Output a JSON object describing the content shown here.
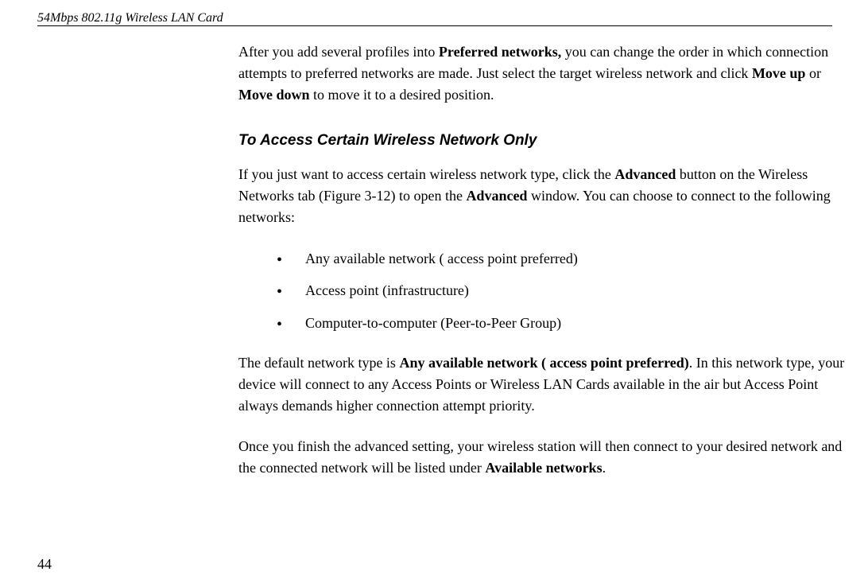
{
  "header": "54Mbps 802.11g Wireless LAN Card",
  "page_number": "44",
  "para1_t1": "After you add several profiles into ",
  "para1_b1": "Preferred networks,",
  "para1_t2": " you can change the order in which connection attempts to preferred networks are made. Just select the target wireless network and click ",
  "para1_b2": "Move up",
  "para1_t3": " or ",
  "para1_b3": "Move down",
  "para1_t4": " to move it to a desired position.",
  "subheading": "To Access Certain Wireless Network Only",
  "para2_t1": "If you just want to access certain wireless network type, click the ",
  "para2_b1": "Advanced",
  "para2_t2": " button on the Wireless Networks tab (Figure 3-12) to open the ",
  "para2_b2": "Advanced",
  "para2_t3": " window. You can choose to connect to the following networks:",
  "bullet1": "Any available network ( access point preferred)",
  "bullet2": "Access point (infrastructure)",
  "bullet3": "Computer-to-computer (Peer-to-Peer Group)",
  "para3_t1": "The default network type is ",
  "para3_b1": "Any available network ( access point preferred)",
  "para3_t2": ". In this network type, your device will connect to any Access Points or Wireless LAN Cards available in the air but Access Point always demands higher connection attempt priority.",
  "para4_t1": "Once you finish the advanced setting, your wireless station will then connect to your desired network and the connected network will be listed under ",
  "para4_b1": "Available networks",
  "para4_t2": "."
}
